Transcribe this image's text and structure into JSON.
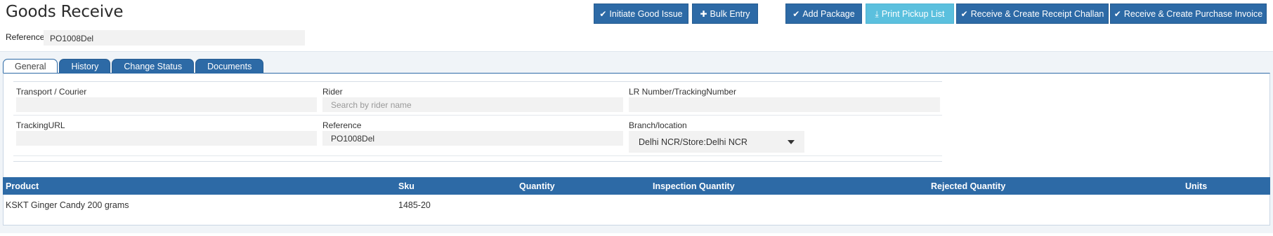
{
  "page": {
    "title": "Goods Receive"
  },
  "actions": {
    "initiate_issue": "Initiate Good Issue",
    "bulk_entry": "Bulk Entry",
    "add_package": "Add Package",
    "print_pickup": "Print Pickup List",
    "receive_challan": "Receive & Create Receipt Challan",
    "receive_invoice": "Receive & Create Purchase Invoice"
  },
  "reference": {
    "label": "Reference",
    "value": "PO1008Del"
  },
  "tabs": [
    {
      "label": "General"
    },
    {
      "label": "History"
    },
    {
      "label": "Change Status"
    },
    {
      "label": "Documents"
    }
  ],
  "form": {
    "transport": {
      "label": "Transport / Courier",
      "value": ""
    },
    "rider": {
      "label": "Rider",
      "placeholder": "Search by rider name"
    },
    "lr_number": {
      "label": "LR Number/TrackingNumber",
      "value": ""
    },
    "tracking_url": {
      "label": "TrackingURL",
      "value": ""
    },
    "reference": {
      "label": "Reference",
      "value": "PO1008Del"
    },
    "branch": {
      "label": "Branch/location",
      "value": "Delhi NCR/Store:Delhi NCR"
    }
  },
  "table": {
    "columns": [
      "Product",
      "Sku",
      "Quantity",
      "Inspection Quantity",
      "Rejected Quantity",
      "Units"
    ],
    "rows": [
      {
        "product": "KSKT Ginger Candy 200 grams",
        "sku": "1485-20",
        "quantity": "",
        "inspection_quantity": "",
        "rejected_quantity": "",
        "units": ""
      }
    ]
  },
  "colors": {
    "primary": "#2d6aa6",
    "info": "#5bc0de",
    "panel": "#f0f4f8"
  },
  "icons": {
    "check": "check-icon",
    "plus": "plus-icon",
    "download": "download-icon",
    "caret": "chevron-down-icon"
  }
}
